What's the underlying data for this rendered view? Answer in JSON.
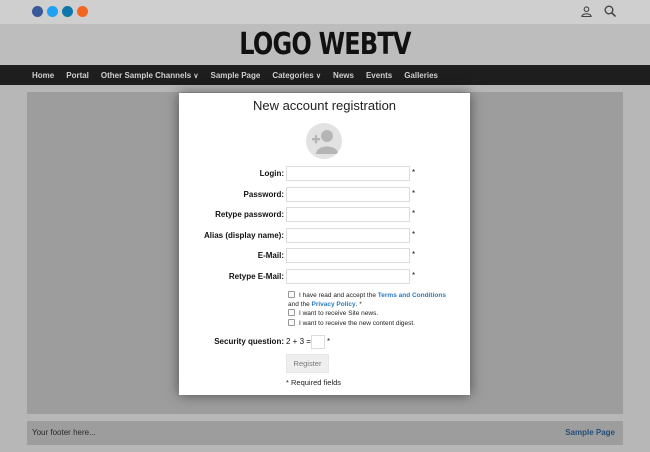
{
  "site": {
    "logo": "LOGO WEBTV",
    "social": [
      {
        "name": "facebook",
        "color": "#3b5998"
      },
      {
        "name": "twitter",
        "color": "#1da1f2"
      },
      {
        "name": "linkedin",
        "color": "#0e76a8"
      },
      {
        "name": "rss",
        "color": "#f26522"
      }
    ],
    "nav": [
      "Home",
      "Portal",
      "Other Sample Channels",
      "Sample Page",
      "Categories",
      "News",
      "Events",
      "Galleries"
    ],
    "footer": {
      "text": "Your footer here...",
      "link": "Sample Page"
    }
  },
  "modal": {
    "title": "New account registration",
    "fields": [
      {
        "label": "Login:",
        "required": "*"
      },
      {
        "label": "Password:",
        "required": "*"
      },
      {
        "label": "Retype password:",
        "required": "*"
      },
      {
        "label": "Alias (display name):",
        "required": "*"
      },
      {
        "label": "E-Mail:",
        "required": "*"
      },
      {
        "label": "Retype E-Mail:",
        "required": "*"
      }
    ],
    "terms": {
      "prefix": "I have read and accept the",
      "terms_link": "Terms and Conditions",
      "middle": "and the",
      "privacy_link": "Privacy Policy",
      "suffix": ". *"
    },
    "site_news": "I want to receive Site news.",
    "digest": "I want to receive the new content digest.",
    "security": {
      "label": "Security question:",
      "question": "2 + 3 =",
      "required": "*"
    },
    "register_label": "Register",
    "required_note": "* Required fields"
  }
}
